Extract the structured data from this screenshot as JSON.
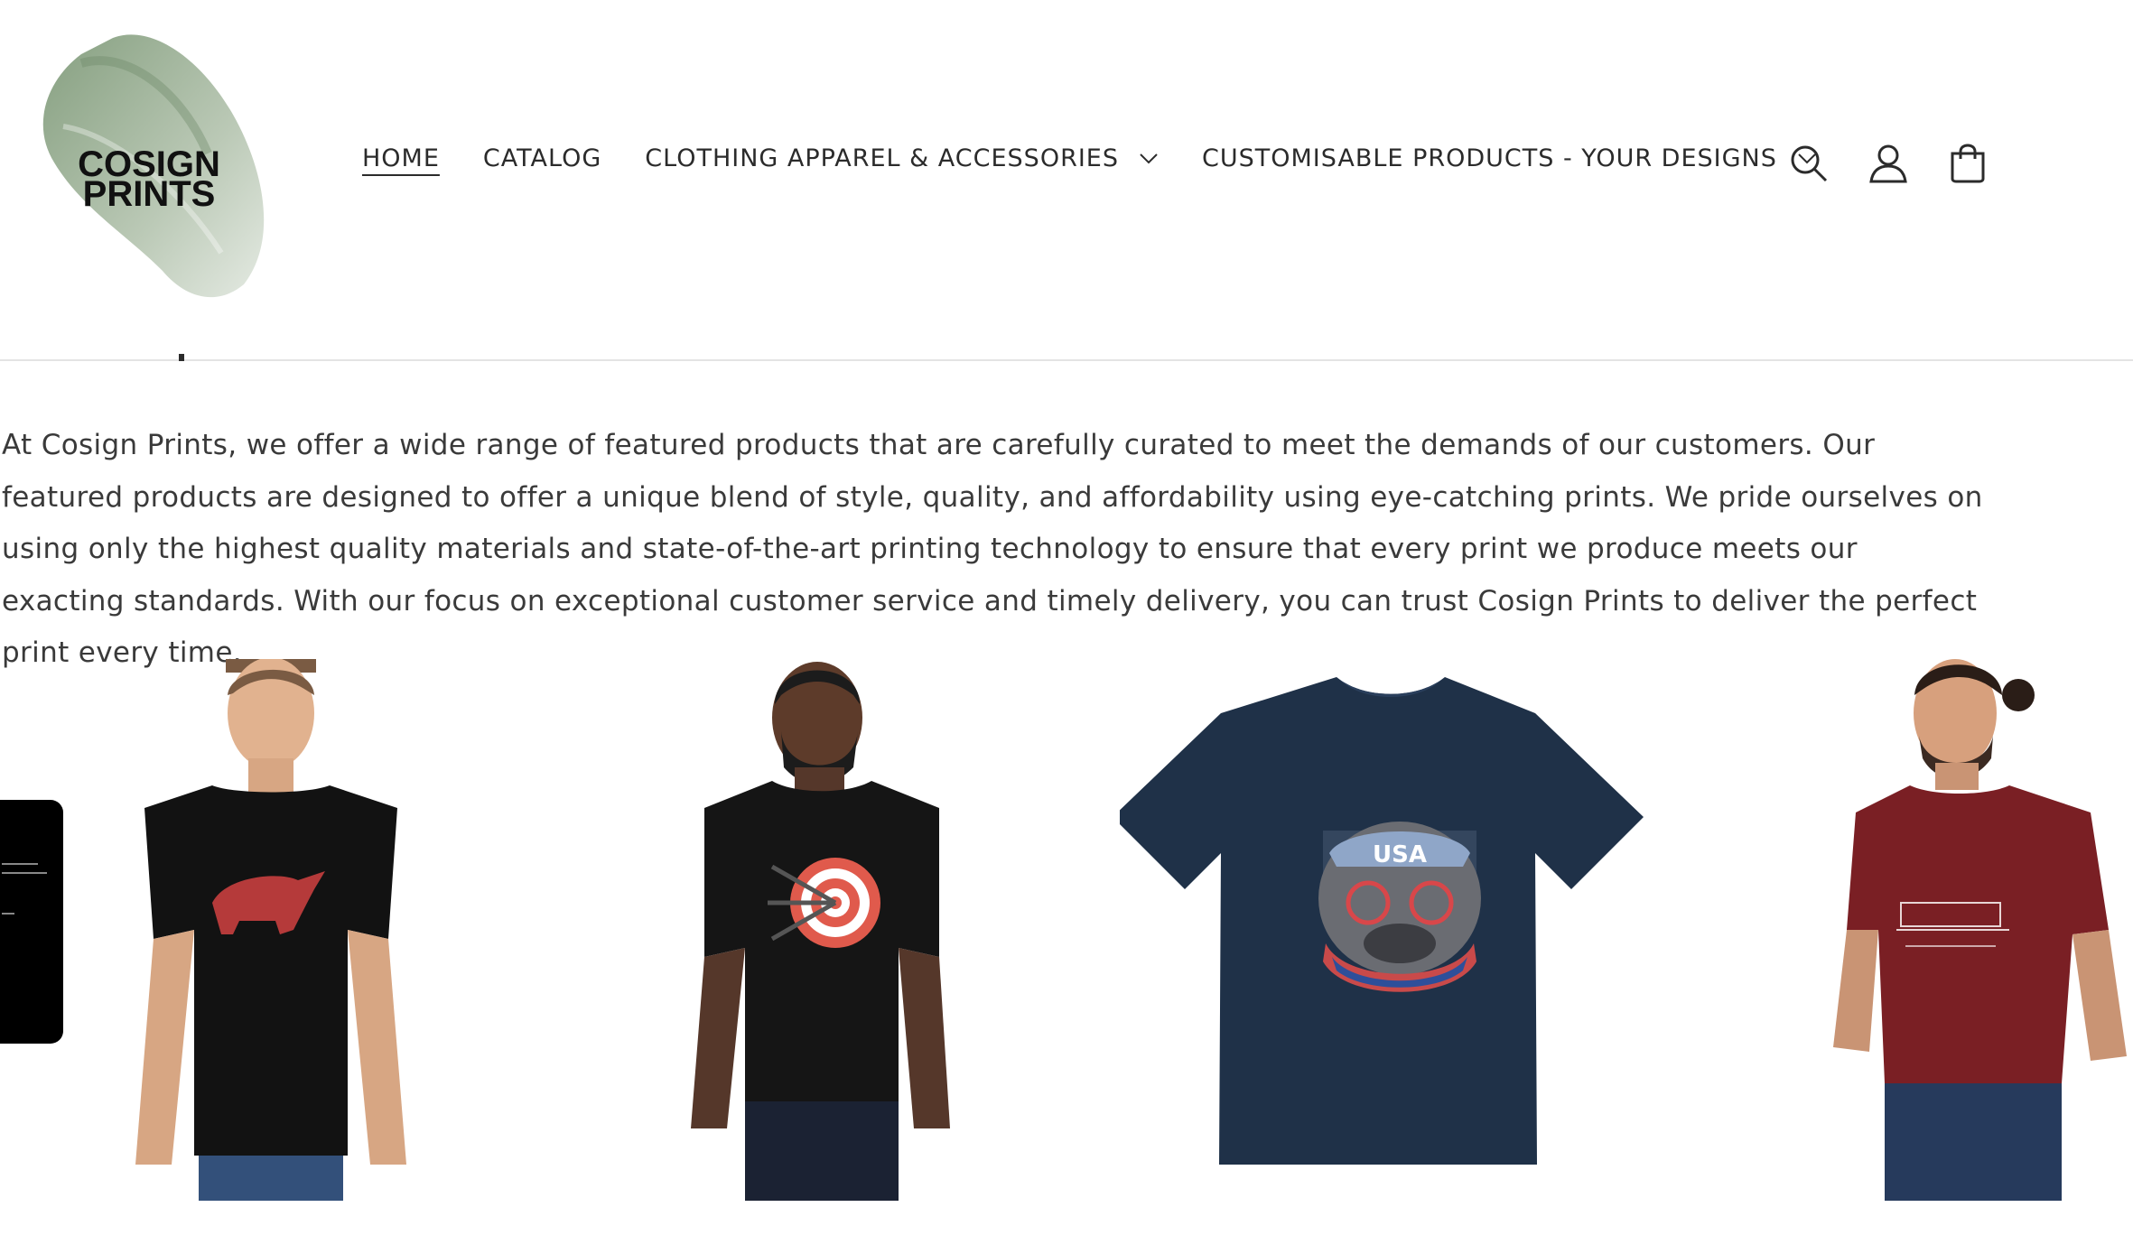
{
  "header": {
    "logo": {
      "line1": "COSIGN",
      "line2": "PRINTS"
    },
    "nav": [
      {
        "label": "HOME",
        "active": true,
        "dropdown": false
      },
      {
        "label": "CATALOG",
        "active": false,
        "dropdown": false
      },
      {
        "label": "CLOTHING APPAREL & ACCESSORIES",
        "active": false,
        "dropdown": true
      },
      {
        "label": "CUSTOMISABLE PRODUCTS - YOUR DESIGNS",
        "active": false,
        "dropdown": true
      }
    ],
    "icons": [
      "search-icon",
      "account-icon",
      "cart-icon"
    ]
  },
  "intro": {
    "text": "At Cosign Prints, we offer a wide range of featured products that are carefully curated to meet the demands of our customers. Our featured products are designed to offer a unique blend of style, quality, and affordability using eye-catching prints. We pride ourselves on using only the highest quality materials and state-of-the-art printing technology to ensure that every print we produce meets our exacting standards. With our focus on exceptional customer service and timely delivery, you can trust Cosign Prints to deliver the perfect print every time."
  },
  "products": [
    {
      "image": "black-tshirt-bull-print",
      "shirt_color": "#121212"
    },
    {
      "image": "black-tshirt-target-print",
      "shirt_color": "#151515"
    },
    {
      "image": "navy-tshirt-usa-bulldog-print",
      "shirt_color": "#1f3148",
      "print_text": "USA"
    },
    {
      "image": "maroon-tshirt-classic-car-print",
      "shirt_color": "#7a1f24"
    }
  ],
  "colors": {
    "text": "#2b2b2b",
    "divider": "#e4e4e4",
    "logo_brush": "#8fa68a"
  }
}
